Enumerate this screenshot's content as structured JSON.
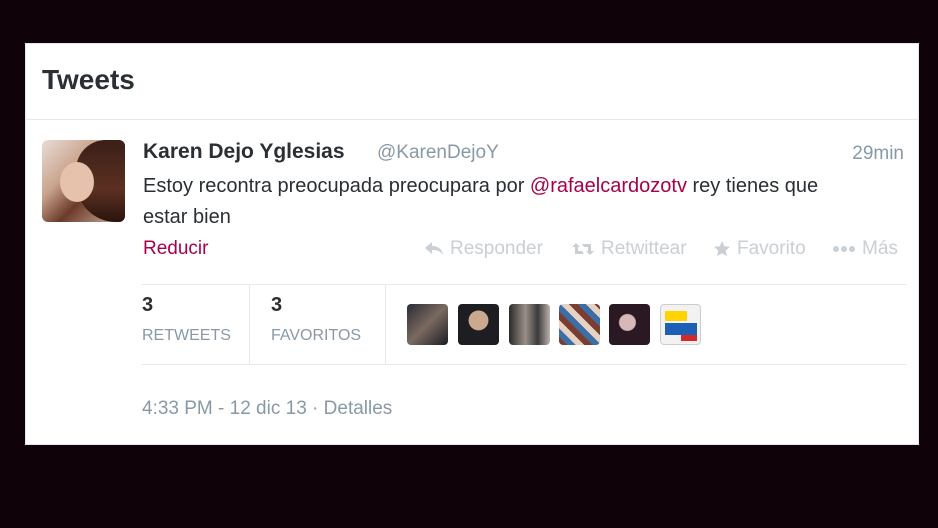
{
  "header": {
    "title": "Tweets"
  },
  "tweet": {
    "author_name": "Karen Dejo Yglesias",
    "author_handle": "@KarenDejoY",
    "time_ago": "29min",
    "text_before": "Estoy recontra preocupada preocupara por ",
    "mention": "@rafaelcardozotv",
    "text_after": " rey tienes que estar bien",
    "collapse_label": "Reducir"
  },
  "actions": {
    "reply": "Responder",
    "retweet": "Retwittear",
    "favorite": "Favorito",
    "more": "Más"
  },
  "stats": {
    "retweets_count": "3",
    "retweets_label": "RETWEETS",
    "favorites_count": "3",
    "favorites_label": "FAVORITOS"
  },
  "footer": {
    "timestamp": "4:33 PM - 12 dic 13",
    "separator": " · ",
    "details_label": "Detalles"
  },
  "colors": {
    "link": "#a8004b",
    "muted": "#8899a6",
    "text": "#292f33",
    "action_disabled": "#c8cfd5"
  }
}
